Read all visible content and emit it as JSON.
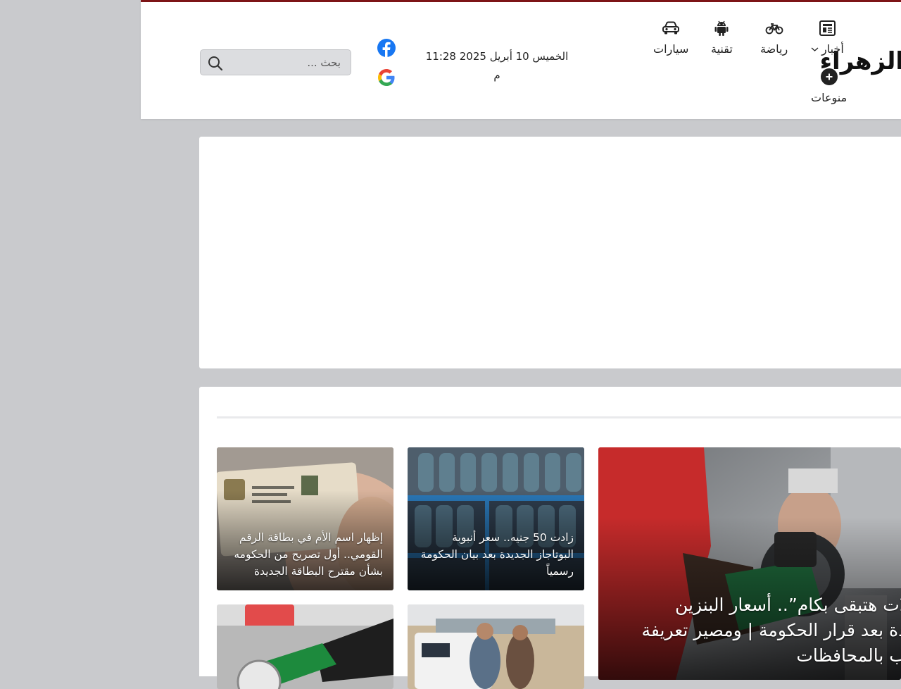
{
  "header": {
    "logo_text": "الزهراء",
    "nav": [
      {
        "label": "أخبار",
        "icon": "newspaper-icon"
      },
      {
        "label": "رياضة",
        "icon": "bicycle-icon"
      },
      {
        "label": "تقنية",
        "icon": "android-icon"
      },
      {
        "label": "سيارات",
        "icon": "car-icon"
      },
      {
        "label": "منوعات",
        "icon": "plus-circle-icon"
      }
    ],
    "date_line1": "الخميس 10 أبريل 2025 11:28",
    "date_line2": "م",
    "social": [
      "facebook-icon",
      "google-icon"
    ],
    "search_placeholder": "بحث ..."
  },
  "news": [
    {
      "title": "هتعملات هتبقى بكام”.. أسعار البنزين الجديدة بعد قرار الحكومة | ومصير تعريفة الركوب بالمحافظات"
    },
    {
      "title": "زادت 50 جنيه.. سعر أنبوبة البوتاجاز الجديدة بعد بيان الحكومة رسمياً"
    },
    {
      "title": "إظهار اسم الأم في بطاقة الرقم القومي.. أول تصريح من الحكومه بشأن مقترح البطاقة الجديدة"
    }
  ],
  "colors": {
    "brand": "#7d1416",
    "background": "#c9cacd",
    "facebook": "#1877f2"
  }
}
